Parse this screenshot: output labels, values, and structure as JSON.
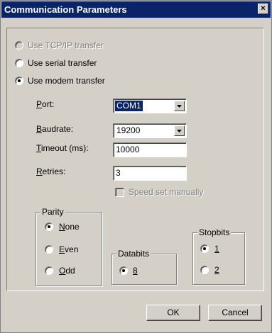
{
  "window": {
    "title": "Communication Parameters",
    "close_glyph": "×"
  },
  "transfer": {
    "tcpip": {
      "label": "Use TCP/IP transfer",
      "enabled": false,
      "selected": false
    },
    "serial": {
      "label": "Use serial transfer",
      "selected": false
    },
    "modem": {
      "label": "Use modem transfer",
      "selected": true
    }
  },
  "port": {
    "label_first": "P",
    "label_rest": "ort:",
    "value": "COM1"
  },
  "baudrate": {
    "label_first": "B",
    "label_rest": "audrate:",
    "value": "19200"
  },
  "timeout": {
    "label_first": "T",
    "label_rest": "imeout (ms):",
    "value": "10000"
  },
  "retries": {
    "label_first": "R",
    "label_rest": "etries:",
    "value": "3"
  },
  "speed_manual": {
    "label": "Speed set manually",
    "checked": false,
    "enabled": false
  },
  "parity": {
    "title": "Parity",
    "none": {
      "first": "N",
      "rest": "one",
      "selected": true
    },
    "even": {
      "first": "E",
      "rest": "ven",
      "selected": false
    },
    "odd": {
      "first": "O",
      "rest": "dd",
      "selected": false
    }
  },
  "databits": {
    "title": "Databits",
    "eight": {
      "label": "8",
      "selected": true
    }
  },
  "stopbits": {
    "title": "Stopbits",
    "one": {
      "label": "1",
      "selected": true
    },
    "two": {
      "label": "2",
      "selected": false
    }
  },
  "buttons": {
    "ok": "OK",
    "cancel": "Cancel"
  }
}
